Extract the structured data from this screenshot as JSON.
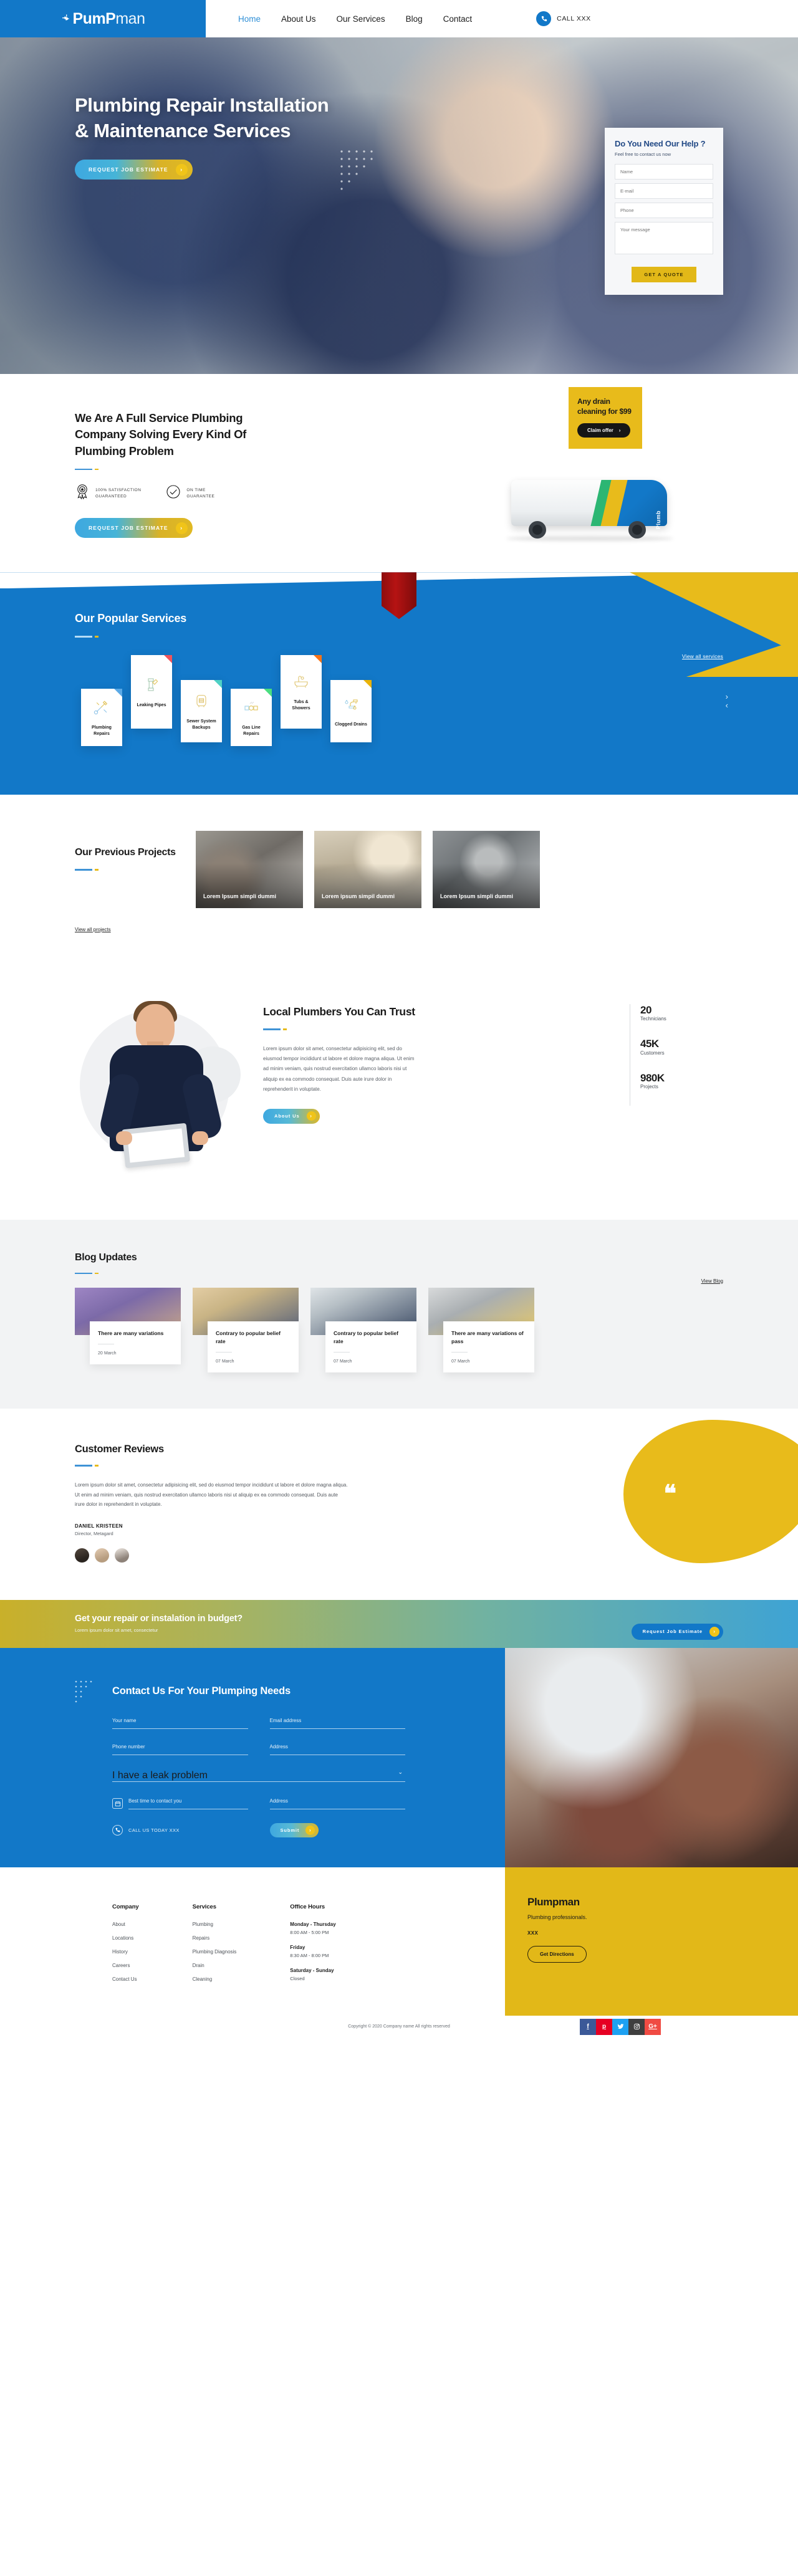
{
  "brand": {
    "name_bold": "PumP",
    "name_light": "man",
    "logo_icon": "faucet-icon"
  },
  "nav": {
    "items": [
      {
        "label": "Home",
        "active": true
      },
      {
        "label": "About Us",
        "active": false
      },
      {
        "label": "Our Services",
        "active": false
      },
      {
        "label": "Blog",
        "active": false
      },
      {
        "label": "Contact",
        "active": false
      }
    ],
    "call_label": "CALL XXX",
    "call_icon": "phone-icon"
  },
  "hero": {
    "title": "Plumbing Repair Installation & Maintenance Services",
    "cta_label": "Request Job Estimate",
    "cta_arrow": "chevron-right-icon",
    "form": {
      "heading": "Do You Need Our Help ?",
      "subheading": "Feel free to contact us now",
      "name_placeholder": "Name",
      "email_placeholder": "E-mail",
      "phone_placeholder": "Phone",
      "message_placeholder": "Your message",
      "submit_label": "GET A QUOTE"
    }
  },
  "offer": {
    "title": "Any drain cleaning for $99",
    "button_label": "Claim offer",
    "button_arrow": "chevron-right-icon"
  },
  "full_service": {
    "title": "We Are A Full Service Plumbing Company Solving Every Kind Of Plumbing Problem",
    "badges": [
      {
        "icon": "ribbon-award-icon",
        "line1": "100% SATISFACTION",
        "line2": "GUARANTEED"
      },
      {
        "icon": "check-circle-icon",
        "line1": "ON TIME",
        "line2": "GUARANTEE"
      }
    ],
    "cta_label": "Request Job Estimate",
    "van_label": "Plumb"
  },
  "services": {
    "title": "Our Popular Services",
    "view_all_label": "View all services",
    "next_icon": "chevron-right-icon",
    "prev_icon": "chevron-left-icon",
    "cards": [
      {
        "name": "Plumbing Repairs",
        "icon": "wrench-screwdriver-icon",
        "corner": "#5aa9e6"
      },
      {
        "name": "Leaking Pipes",
        "icon": "pipe-joint-icon",
        "corner": "#f2545b"
      },
      {
        "name": "Sewer System Backups",
        "icon": "water-heater-icon",
        "corner": "#4fd1c5"
      },
      {
        "name": "Gas Line Repairs",
        "icon": "gas-valve-icon",
        "corner": "#4ade80"
      },
      {
        "name": "Tubs & Showers",
        "icon": "bathtub-icon",
        "corner": "#f97316"
      },
      {
        "name": "Clogged Drains",
        "icon": "faucet-drip-icon",
        "corner": "#eab308"
      }
    ]
  },
  "projects": {
    "title": "Our Previous Projects",
    "view_label": "View all projects",
    "cards": [
      {
        "caption": "Lorem Ipsum simpli dummi"
      },
      {
        "caption": "Lorem ipsum simpil dummi"
      },
      {
        "caption": "Lorem Ipsum simpli dummi"
      }
    ]
  },
  "trust": {
    "title": "Local Plumbers You Can Trust",
    "paragraph": "Lorem ipsum dolor sit amet, consectetur adipisicing elit, sed do eiusmod tempor incididunt ut labore et dolore magna aliqua. Ut enim ad minim veniam, quis nostrud exercitation ullamco laboris nisi ut aliquip ex ea commodo consequat. Duis aute irure dolor in reprehenderit in voluptate.",
    "cta_label": "About Us",
    "stats": [
      {
        "number": "20",
        "label": "Technicians"
      },
      {
        "number": "45K",
        "label": "Customers"
      },
      {
        "number": "980K",
        "label": "Projects"
      }
    ]
  },
  "blog": {
    "title": "Blog Updates",
    "view_label": "View Blog",
    "posts": [
      {
        "title": "There are many variations",
        "day": "20",
        "month": "March"
      },
      {
        "title": "Contrary to popular belief rate",
        "day": "07",
        "month": "March"
      },
      {
        "title": "Contrary to popular belief rate",
        "day": "07",
        "month": "March"
      },
      {
        "title": "There are many variations of pass",
        "day": "07",
        "month": "March"
      }
    ]
  },
  "reviews": {
    "title": "Customer Reviews",
    "quote_icon": "quote-mark-icon",
    "text": "Lorem ipsum dolor sit amet, consectetur adipisicing elit, sed do eiusmod tempor incididunt ut labore et dolore magna aliqua. Ut enim ad minim veniam, quis nostrud exercitation ullamco laboris nisi ut aliquip ex ea commodo consequat. Duis aute irure dolor in reprehenderit in voluptate.",
    "author": "DANIEL KRISTEEN",
    "role": "Director, Metagard"
  },
  "cta_bar": {
    "title": "Get your repair or instalation in budget?",
    "subtitle": "Lorem ipsum dolor sit amet, consectetur",
    "button_label": "Request Job Estimate"
  },
  "contact": {
    "title": "Contact Us For Your Plumping Needs",
    "fields": {
      "name": "Your name",
      "email": "Email address",
      "phone": "Phone number",
      "address": "Address",
      "problem_selected": "I have a leak problem",
      "best_time": "Best time to contact you",
      "time_address": "Address"
    },
    "chevron_icon": "chevron-down-icon",
    "calendar_icon": "calendar-icon",
    "phone_icon": "phone-icon",
    "call_today_label": "CALL US TODAY XXX",
    "submit_label": "Submit",
    "submit_arrow": "chevron-right-icon"
  },
  "footer": {
    "columns": [
      {
        "heading": "Company",
        "links": [
          "About",
          "Locations",
          "History",
          "Careers",
          "Contact Us"
        ]
      },
      {
        "heading": "Services",
        "links": [
          "Plumbing",
          "Repairs",
          "Plumbing Diagnosis",
          "Drain",
          "Cleaning"
        ]
      }
    ],
    "office_hours_heading": "Office Hours",
    "office_hours": [
      {
        "days": "Monday - Thursday",
        "time": "8:00 AM - 5:00 PM"
      },
      {
        "days": "Friday",
        "time": "8:30 AM - 8:00 PM"
      },
      {
        "days": "Saturday - Sunday",
        "time": "Closed"
      }
    ],
    "promo": {
      "name": "Plumpman",
      "tagline": "Plumbing professionals.",
      "phone": "XXX",
      "button_label": "Get Directions"
    },
    "copyright": "Copyright © 2020 Company name All rights reserved",
    "socials": [
      {
        "name": "facebook-icon",
        "glyph": "f",
        "color": "#3b5998"
      },
      {
        "name": "pinterest-icon",
        "glyph": "p",
        "color": "#e60023"
      },
      {
        "name": "twitter-icon",
        "glyph": "t",
        "color": "#1da1f2"
      },
      {
        "name": "instagram-icon",
        "glyph": "o",
        "color": "#3f3f3f"
      },
      {
        "name": "googleplus-icon",
        "glyph": "G+",
        "color": "#f04b43"
      }
    ]
  },
  "colors": {
    "primary": "#1278c8",
    "accent": "#e8bb1b",
    "dark": "#161616"
  }
}
